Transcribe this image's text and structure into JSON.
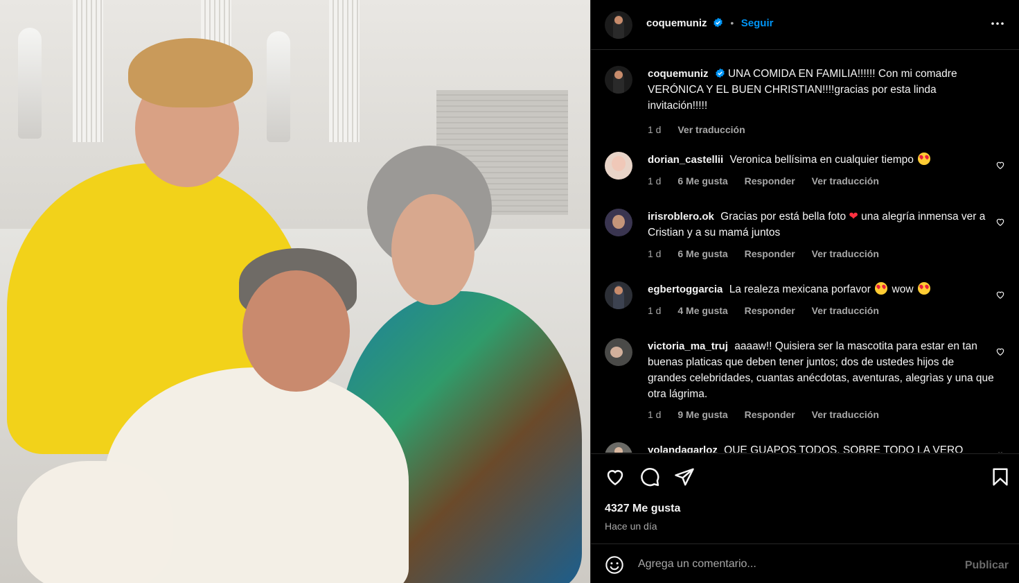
{
  "header": {
    "username": "coquemuniz",
    "follow_label": "Seguir",
    "more_icon": "more-horizontal-icon"
  },
  "caption": {
    "username": "coquemuniz",
    "text": "UNA COMIDA EN FAMILIA!!!!!! Con mi comadre VERÓNICA Y EL BUEN CHRISTIAN!!!!gracias por esta linda invitación!!!!!",
    "time": "1 d",
    "translate": "Ver traducción"
  },
  "comments": [
    {
      "username": "dorian_castellii",
      "text": "Veronica bellísima en cualquier tiempo",
      "time": "1 d",
      "likes": "6 Me gusta",
      "reply": "Responder",
      "translate": "Ver traducción"
    },
    {
      "username": "irisroblero.ok",
      "text_a": "Gracias por está bella foto",
      "text_b": "una alegría inmensa ver a Cristian y a su mamá juntos",
      "time": "1 d",
      "likes": "6 Me gusta",
      "reply": "Responder",
      "translate": "Ver traducción"
    },
    {
      "username": "egbertoggarcia",
      "text_a": "La realeza mexicana porfavor",
      "text_b": "wow",
      "time": "1 d",
      "likes": "4 Me gusta",
      "reply": "Responder",
      "translate": "Ver traducción"
    },
    {
      "username": "victoria_ma_truj",
      "text": "aaaaw!! Quisiera ser la mascotita para estar en tan buenas platicas que deben tener juntos; dos de ustedes hijos de grandes celebridades, cuantas anécdotas, aventuras, alegrìas y una que otra lágrima.",
      "time": "1 d",
      "likes": "9 Me gusta",
      "reply": "Responder",
      "translate": "Ver traducción"
    },
    {
      "username": "yolandagarloz",
      "text": "QUE GUAPOS TODOS, SOBRE TODO LA VERO"
    }
  ],
  "actions": {
    "like_icon": "heart-outline-icon",
    "comment_icon": "comment-icon",
    "share_icon": "paper-plane-icon",
    "save_icon": "bookmark-icon",
    "likes": "4327 Me gusta",
    "posted": "Hace un día"
  },
  "composer": {
    "emoji_icon": "smiley-icon",
    "placeholder": "Agrega un comentario...",
    "post_label": "Publicar"
  },
  "colors": {
    "background": "#000000",
    "accent": "#0095f6",
    "muted": "#a8a8a8",
    "verified": "#0095f6"
  }
}
